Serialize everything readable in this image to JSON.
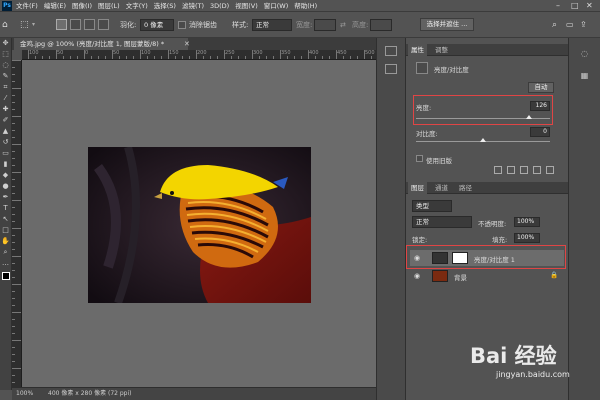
{
  "menubar": {
    "items": [
      "文件(F)",
      "编辑(E)",
      "图像(I)",
      "图层(L)",
      "文字(Y)",
      "选择(S)",
      "滤镜(T)",
      "3D(D)",
      "视图(V)",
      "窗口(W)",
      "帮助(H)"
    ]
  },
  "options": {
    "feather_label": "羽化:",
    "feather_value": "0 像素",
    "antialias_label": "消除锯齿",
    "style_label": "样式:",
    "style_value": "正常",
    "width_label": "宽度:",
    "height_label": "高度:",
    "select_mask_button": "选择并遮住 ..."
  },
  "document": {
    "tab_title": "金鸡.jpg @ 100% (亮度/对比度 1, 图层蒙版/8) *",
    "zoom": "100%",
    "status": "400 像素 x 280 像素 (72 ppi)",
    "ruler_numbers": [
      "100",
      "50",
      "0",
      "50",
      "100",
      "150",
      "200",
      "250",
      "300",
      "350",
      "400",
      "450",
      "500"
    ]
  },
  "properties": {
    "tabs": [
      "属性",
      "调整"
    ],
    "adjustment_name": "亮度/对比度",
    "auto_button": "自动",
    "brightness_label": "亮度:",
    "brightness_value": "126",
    "brightness_fraction": 0.84,
    "contrast_label": "对比度:",
    "contrast_value": "0",
    "contrast_fraction": 0.5,
    "legacy_label": "使用旧版"
  },
  "layers": {
    "tabs": [
      "图层",
      "通道",
      "路径"
    ],
    "filter_kind": "类型",
    "blend_mode": "正常",
    "opacity_label": "不透明度:",
    "opacity_value": "100%",
    "lock_label": "锁定:",
    "fill_label": "填充:",
    "fill_value": "100%",
    "items": [
      {
        "name": "亮度/对比度 1",
        "type": "adjustment"
      },
      {
        "name": "背景",
        "type": "background"
      }
    ]
  },
  "watermark": {
    "main": "Bai 经验",
    "sub": "jingyan.baidu.com"
  },
  "colors": {
    "ui_bg": "#535353",
    "canvas_bg": "#6b6b6b",
    "highlight": "#e04545",
    "selected_layer": "#6c6c6c"
  }
}
